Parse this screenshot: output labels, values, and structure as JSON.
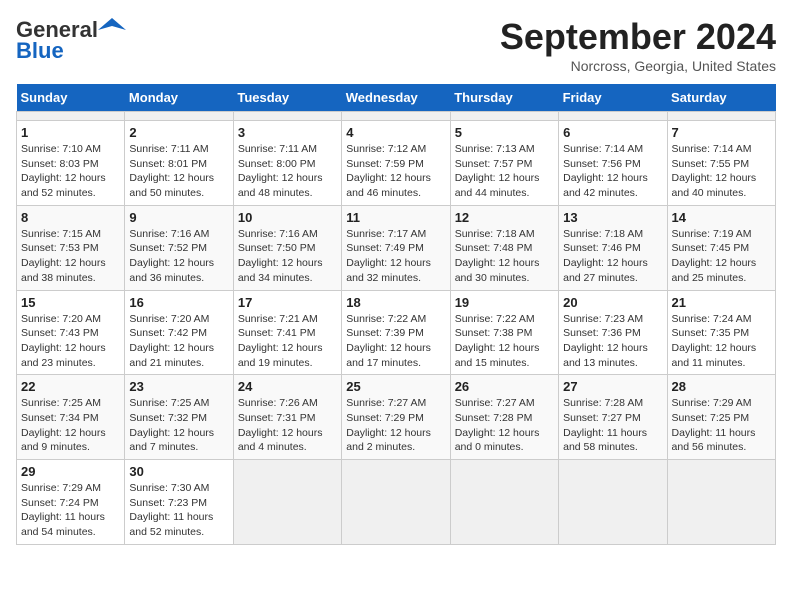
{
  "header": {
    "logo_line1": "General",
    "logo_line2": "Blue",
    "title": "September 2024",
    "subtitle": "Norcross, Georgia, United States"
  },
  "calendar": {
    "days_of_week": [
      "Sunday",
      "Monday",
      "Tuesday",
      "Wednesday",
      "Thursday",
      "Friday",
      "Saturday"
    ],
    "weeks": [
      [
        {
          "day": "",
          "empty": true
        },
        {
          "day": "",
          "empty": true
        },
        {
          "day": "",
          "empty": true
        },
        {
          "day": "",
          "empty": true
        },
        {
          "day": "",
          "empty": true
        },
        {
          "day": "",
          "empty": true
        },
        {
          "day": "",
          "empty": true
        }
      ],
      [
        {
          "day": "1",
          "sunrise": "7:10 AM",
          "sunset": "8:03 PM",
          "daylight": "12 hours and 52 minutes."
        },
        {
          "day": "2",
          "sunrise": "7:11 AM",
          "sunset": "8:01 PM",
          "daylight": "12 hours and 50 minutes."
        },
        {
          "day": "3",
          "sunrise": "7:11 AM",
          "sunset": "8:00 PM",
          "daylight": "12 hours and 48 minutes."
        },
        {
          "day": "4",
          "sunrise": "7:12 AM",
          "sunset": "7:59 PM",
          "daylight": "12 hours and 46 minutes."
        },
        {
          "day": "5",
          "sunrise": "7:13 AM",
          "sunset": "7:57 PM",
          "daylight": "12 hours and 44 minutes."
        },
        {
          "day": "6",
          "sunrise": "7:14 AM",
          "sunset": "7:56 PM",
          "daylight": "12 hours and 42 minutes."
        },
        {
          "day": "7",
          "sunrise": "7:14 AM",
          "sunset": "7:55 PM",
          "daylight": "12 hours and 40 minutes."
        }
      ],
      [
        {
          "day": "8",
          "sunrise": "7:15 AM",
          "sunset": "7:53 PM",
          "daylight": "12 hours and 38 minutes."
        },
        {
          "day": "9",
          "sunrise": "7:16 AM",
          "sunset": "7:52 PM",
          "daylight": "12 hours and 36 minutes."
        },
        {
          "day": "10",
          "sunrise": "7:16 AM",
          "sunset": "7:50 PM",
          "daylight": "12 hours and 34 minutes."
        },
        {
          "day": "11",
          "sunrise": "7:17 AM",
          "sunset": "7:49 PM",
          "daylight": "12 hours and 32 minutes."
        },
        {
          "day": "12",
          "sunrise": "7:18 AM",
          "sunset": "7:48 PM",
          "daylight": "12 hours and 30 minutes."
        },
        {
          "day": "13",
          "sunrise": "7:18 AM",
          "sunset": "7:46 PM",
          "daylight": "12 hours and 27 minutes."
        },
        {
          "day": "14",
          "sunrise": "7:19 AM",
          "sunset": "7:45 PM",
          "daylight": "12 hours and 25 minutes."
        }
      ],
      [
        {
          "day": "15",
          "sunrise": "7:20 AM",
          "sunset": "7:43 PM",
          "daylight": "12 hours and 23 minutes."
        },
        {
          "day": "16",
          "sunrise": "7:20 AM",
          "sunset": "7:42 PM",
          "daylight": "12 hours and 21 minutes."
        },
        {
          "day": "17",
          "sunrise": "7:21 AM",
          "sunset": "7:41 PM",
          "daylight": "12 hours and 19 minutes."
        },
        {
          "day": "18",
          "sunrise": "7:22 AM",
          "sunset": "7:39 PM",
          "daylight": "12 hours and 17 minutes."
        },
        {
          "day": "19",
          "sunrise": "7:22 AM",
          "sunset": "7:38 PM",
          "daylight": "12 hours and 15 minutes."
        },
        {
          "day": "20",
          "sunrise": "7:23 AM",
          "sunset": "7:36 PM",
          "daylight": "12 hours and 13 minutes."
        },
        {
          "day": "21",
          "sunrise": "7:24 AM",
          "sunset": "7:35 PM",
          "daylight": "12 hours and 11 minutes."
        }
      ],
      [
        {
          "day": "22",
          "sunrise": "7:25 AM",
          "sunset": "7:34 PM",
          "daylight": "12 hours and 9 minutes."
        },
        {
          "day": "23",
          "sunrise": "7:25 AM",
          "sunset": "7:32 PM",
          "daylight": "12 hours and 7 minutes."
        },
        {
          "day": "24",
          "sunrise": "7:26 AM",
          "sunset": "7:31 PM",
          "daylight": "12 hours and 4 minutes."
        },
        {
          "day": "25",
          "sunrise": "7:27 AM",
          "sunset": "7:29 PM",
          "daylight": "12 hours and 2 minutes."
        },
        {
          "day": "26",
          "sunrise": "7:27 AM",
          "sunset": "7:28 PM",
          "daylight": "12 hours and 0 minutes."
        },
        {
          "day": "27",
          "sunrise": "7:28 AM",
          "sunset": "7:27 PM",
          "daylight": "11 hours and 58 minutes."
        },
        {
          "day": "28",
          "sunrise": "7:29 AM",
          "sunset": "7:25 PM",
          "daylight": "11 hours and 56 minutes."
        }
      ],
      [
        {
          "day": "29",
          "sunrise": "7:29 AM",
          "sunset": "7:24 PM",
          "daylight": "11 hours and 54 minutes."
        },
        {
          "day": "30",
          "sunrise": "7:30 AM",
          "sunset": "7:23 PM",
          "daylight": "11 hours and 52 minutes."
        },
        {
          "day": "",
          "empty": true
        },
        {
          "day": "",
          "empty": true
        },
        {
          "day": "",
          "empty": true
        },
        {
          "day": "",
          "empty": true
        },
        {
          "day": "",
          "empty": true
        }
      ]
    ]
  }
}
